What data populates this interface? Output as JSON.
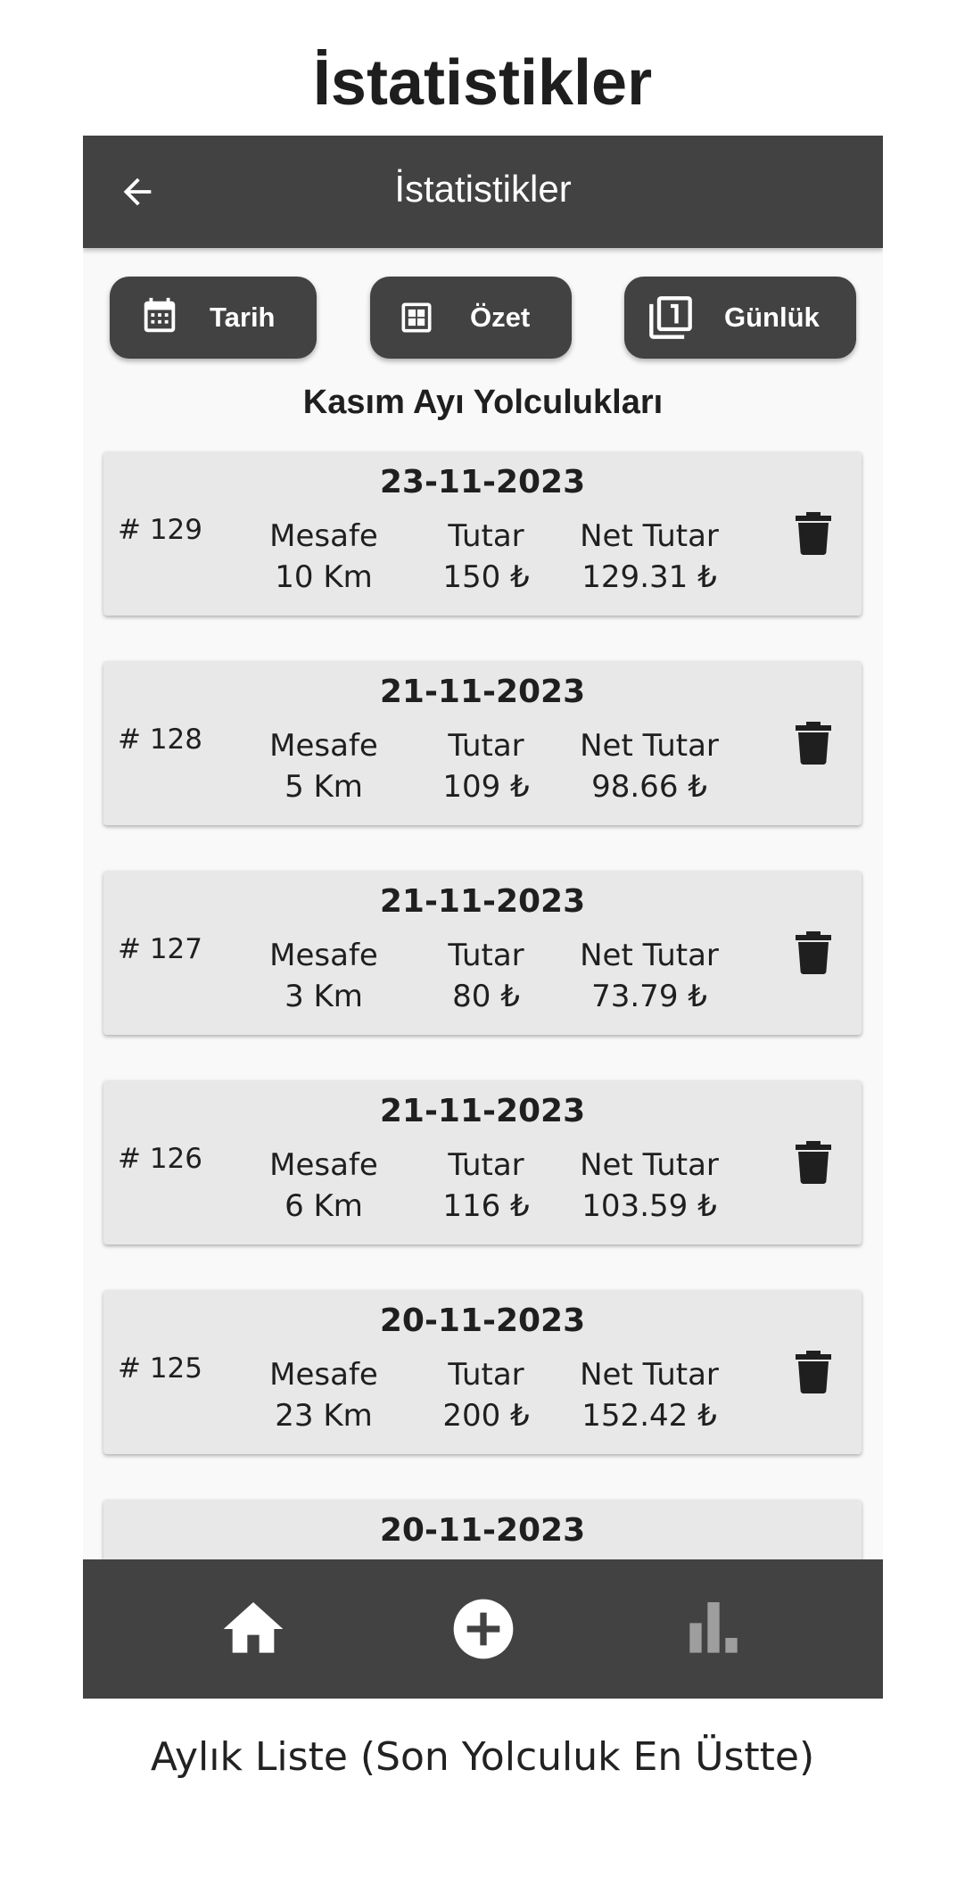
{
  "page_heading": "İstatistikler",
  "caption": "Aylık Liste (Son Yolculuk En Üstte)",
  "app_bar": {
    "title": "İstatistikler",
    "back_icon": "arrow-back-icon"
  },
  "toolbar": {
    "buttons": [
      {
        "label": "Tarih",
        "icon": "calendar-icon"
      },
      {
        "label": "Özet",
        "icon": "grid-summary-icon"
      },
      {
        "label": "Günlük",
        "icon": "filter-one-icon"
      }
    ]
  },
  "section_title": "Kasım Ayı Yolculukları",
  "trips": [
    {
      "date": "23-11-2023",
      "id": "# 129",
      "distance_label": "Mesafe",
      "distance": "10 Km",
      "amount_label": "Tutar",
      "amount": "150 ₺",
      "net_label": "Net Tutar",
      "net": "129.31 ₺"
    },
    {
      "date": "21-11-2023",
      "id": "# 128",
      "distance_label": "Mesafe",
      "distance": "5 Km",
      "amount_label": "Tutar",
      "amount": "109 ₺",
      "net_label": "Net Tutar",
      "net": "98.66 ₺"
    },
    {
      "date": "21-11-2023",
      "id": "# 127",
      "distance_label": "Mesafe",
      "distance": "3 Km",
      "amount_label": "Tutar",
      "amount": "80 ₺",
      "net_label": "Net Tutar",
      "net": "73.79 ₺"
    },
    {
      "date": "21-11-2023",
      "id": "# 126",
      "distance_label": "Mesafe",
      "distance": "6 Km",
      "amount_label": "Tutar",
      "amount": "116 ₺",
      "net_label": "Net Tutar",
      "net": "103.59 ₺"
    },
    {
      "date": "20-11-2023",
      "id": "# 125",
      "distance_label": "Mesafe",
      "distance": "23 Km",
      "amount_label": "Tutar",
      "amount": "200 ₺",
      "net_label": "Net Tutar",
      "net": "152.42 ₺"
    },
    {
      "date": "20-11-2023",
      "id": "",
      "distance_label": "",
      "distance": "",
      "amount_label": "",
      "amount": "",
      "net_label": "",
      "net": ""
    }
  ],
  "bottom_nav": [
    {
      "icon": "home-icon",
      "active": true
    },
    {
      "icon": "add-circle-icon",
      "active": true
    },
    {
      "icon": "bar-chart-icon",
      "active": false
    }
  ],
  "colors": {
    "app_bar": "#424242",
    "card": "#e8e8e8",
    "background": "#f9f9f9",
    "inactive_nav": "#9e9e9e"
  }
}
